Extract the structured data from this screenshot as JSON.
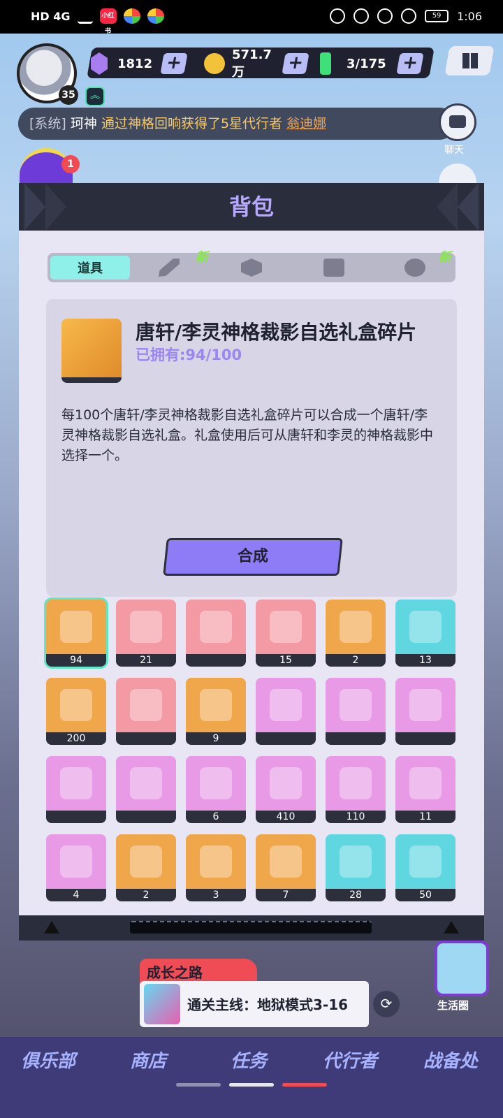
{
  "status_bar": {
    "left": "HD 4G",
    "app_badge": "小红书",
    "battery": "59",
    "time": "1:06"
  },
  "player": {
    "level": "35"
  },
  "resources": [
    {
      "name": "gem",
      "value": "1812",
      "color": "#a77df0"
    },
    {
      "name": "coin",
      "value": "571.7万",
      "color": "#f2c23a"
    },
    {
      "name": "stamina",
      "value": "3/175",
      "color": "#3fe07a"
    }
  ],
  "broadcast": {
    "prefix": "[系统]",
    "user": "珂神",
    "text": "通过神格回响获得了5星代行者",
    "target": "翁迪娜"
  },
  "side": {
    "chat_label": "聊天",
    "event_badge": "1"
  },
  "modal": {
    "title": "背包",
    "tabs": [
      {
        "label": "道具",
        "icon": "items-icon",
        "active": true
      },
      {
        "label": "",
        "icon": "sword-icon",
        "new": "新"
      },
      {
        "label": "",
        "icon": "hexagon-icon"
      },
      {
        "label": "",
        "icon": "puzzle-icon"
      },
      {
        "label": "",
        "icon": "mask-icon",
        "new": "新"
      }
    ],
    "detail": {
      "name": "唐轩/李灵神格裁影自选礼盒碎片",
      "owned": "已拥有:94/100",
      "description": "每100个唐轩/李灵神格裁影自选礼盒碎片可以合成一个唐轩/李灵神格裁影自选礼盒。礼盒使用后可从唐轩和李灵的神格裁影中选择一个。",
      "action": "合成"
    },
    "items": [
      {
        "count": "94",
        "bg": "#f0a64a",
        "icon": "gift-box-fragment-icon",
        "selected": true
      },
      {
        "count": "21",
        "bg": "#f39aa4",
        "icon": "purple-crystal-icon"
      },
      {
        "count": "",
        "bg": "#f39aa4",
        "icon": "teal-prism-icon"
      },
      {
        "count": "15",
        "bg": "#f39aa4",
        "icon": "gold-crystal-icon"
      },
      {
        "count": "2",
        "bg": "#f0a64a",
        "icon": "gift-box-icon"
      },
      {
        "count": "13",
        "bg": "#5fd6e0",
        "icon": "cash-case-icon"
      },
      {
        "count": "200",
        "bg": "#f0a64a",
        "icon": "disc-case-icon"
      },
      {
        "count": "",
        "bg": "#f39aa4",
        "icon": "record-ticket-icon"
      },
      {
        "count": "9",
        "bg": "#f0a64a",
        "icon": "gold-record-icon"
      },
      {
        "count": "",
        "bg": "#e99ae6",
        "icon": "demon-statue-icon"
      },
      {
        "count": "",
        "bg": "#e99ae6",
        "icon": "chocolate-bowl-icon"
      },
      {
        "count": "",
        "bg": "#e99ae6",
        "icon": "chocolate-shell-icon"
      },
      {
        "count": "",
        "bg": "#e99ae6",
        "icon": "cupcake-icon"
      },
      {
        "count": "",
        "bg": "#e99ae6",
        "icon": "dragon-cake-icon"
      },
      {
        "count": "6",
        "bg": "#e99ae6",
        "icon": "cube-box-icon"
      },
      {
        "count": "410",
        "bg": "#e99ae6",
        "icon": "gold-chip-icon"
      },
      {
        "count": "110",
        "bg": "#e99ae6",
        "icon": "green-ore-icon"
      },
      {
        "count": "11",
        "bg": "#e99ae6",
        "icon": "green-triangle-icon"
      },
      {
        "count": "4",
        "bg": "#e99ae6",
        "icon": "gold-triforce-icon"
      },
      {
        "count": "2",
        "bg": "#f0a64a",
        "icon": "pink-record-ticket-icon"
      },
      {
        "count": "3",
        "bg": "#f0a64a",
        "icon": "teal-record-ticket-icon"
      },
      {
        "count": "7",
        "bg": "#f0a64a",
        "icon": "orange-record-ticket-icon"
      },
      {
        "count": "28",
        "bg": "#5fd6e0",
        "icon": "green-cube-icon"
      },
      {
        "count": "50",
        "bg": "#5fd6e0",
        "icon": "blue-cube-icon"
      }
    ]
  },
  "growth": {
    "tab": "成长之路",
    "quest": "通关主线：地狱模式3-16",
    "life_circle": "生活圈"
  },
  "nav": [
    "俱乐部",
    "商店",
    "任务",
    "代行者",
    "战备处"
  ]
}
